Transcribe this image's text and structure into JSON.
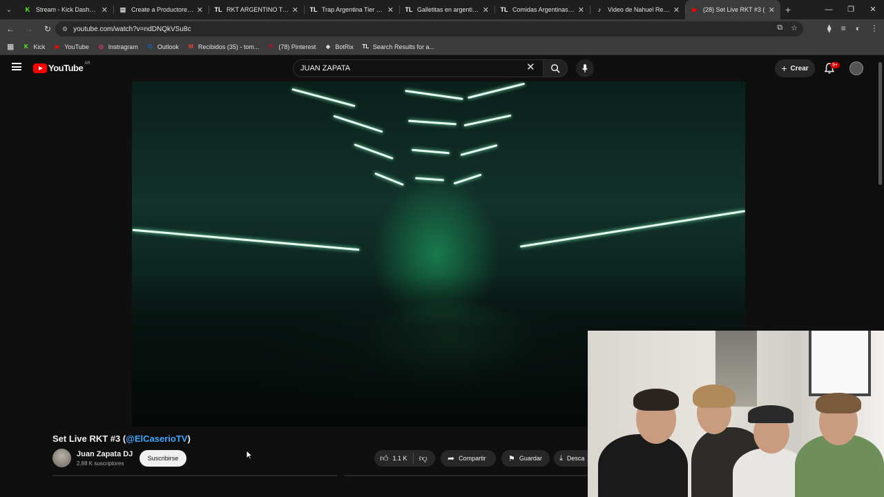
{
  "tabs": [
    {
      "title": "Stream - Kick Dashboard",
      "fav": "K",
      "color": "#53fc18",
      "active": false
    },
    {
      "title": "Create a Productores RKT",
      "fav": "▤",
      "color": "#dddddd",
      "active": false
    },
    {
      "title": "RKT ARGENTINO Tier List",
      "fav": "TL",
      "color": "#ffffff",
      "active": false
    },
    {
      "title": "Trap Argentina Tier List M",
      "fav": "TL",
      "color": "#ffffff",
      "active": false
    },
    {
      "title": "Galletitas en argentina Ti",
      "fav": "TL",
      "color": "#ffffff",
      "active": false
    },
    {
      "title": "Comidas Argentinas Tier",
      "fav": "TL",
      "color": "#ffffff",
      "active": false
    },
    {
      "title": "Video de Nahuel Rey (@",
      "fav": "♪",
      "color": "#ffffff",
      "active": false
    },
    {
      "title": "(28) Set Live RKT #3 (",
      "fav": "▶",
      "color": "#ff0000",
      "active": true
    }
  ],
  "address": {
    "url": "youtube.com/watch?v=ndDNQkVSu8c"
  },
  "bookmarks": [
    {
      "label": "Kick",
      "fav": "K",
      "color": "#53fc18"
    },
    {
      "label": "YouTube",
      "fav": "▶",
      "color": "#ff0000"
    },
    {
      "label": "Instragram",
      "fav": "◎",
      "color": "#e1306c"
    },
    {
      "label": "Outlook",
      "fav": "O",
      "color": "#0a64d6"
    },
    {
      "label": "Recibidos (35) - tom...",
      "fav": "M",
      "color": "#ea4335"
    },
    {
      "label": "(78) Pinterest",
      "fav": "P",
      "color": "#e60023"
    },
    {
      "label": "BotRix",
      "fav": "◆",
      "color": "#dddddd"
    },
    {
      "label": "Search Results for a...",
      "fav": "TL",
      "color": "#ffffff"
    }
  ],
  "youtube": {
    "logo_text": "YouTube",
    "country": "AR",
    "search_value": "JUAN ZAPATA",
    "create_label": "Crear",
    "notification_count": "9+"
  },
  "video": {
    "title_prefix": "Set Live RKT #3 (",
    "title_mention": "@ElCaserioTV",
    "title_suffix": ")",
    "channel_name": "Juan Zapata DJ",
    "subscribers": "2.88 K suscriptores",
    "subscribe_label": "Suscribirse",
    "likes": "1.1 K",
    "share_label": "Compartir",
    "save_label": "Guardar",
    "download_label": "Desca"
  },
  "colors": {
    "youtube_red": "#ff0000",
    "link_blue": "#3ea6ff",
    "kick_green": "#53fc18"
  }
}
